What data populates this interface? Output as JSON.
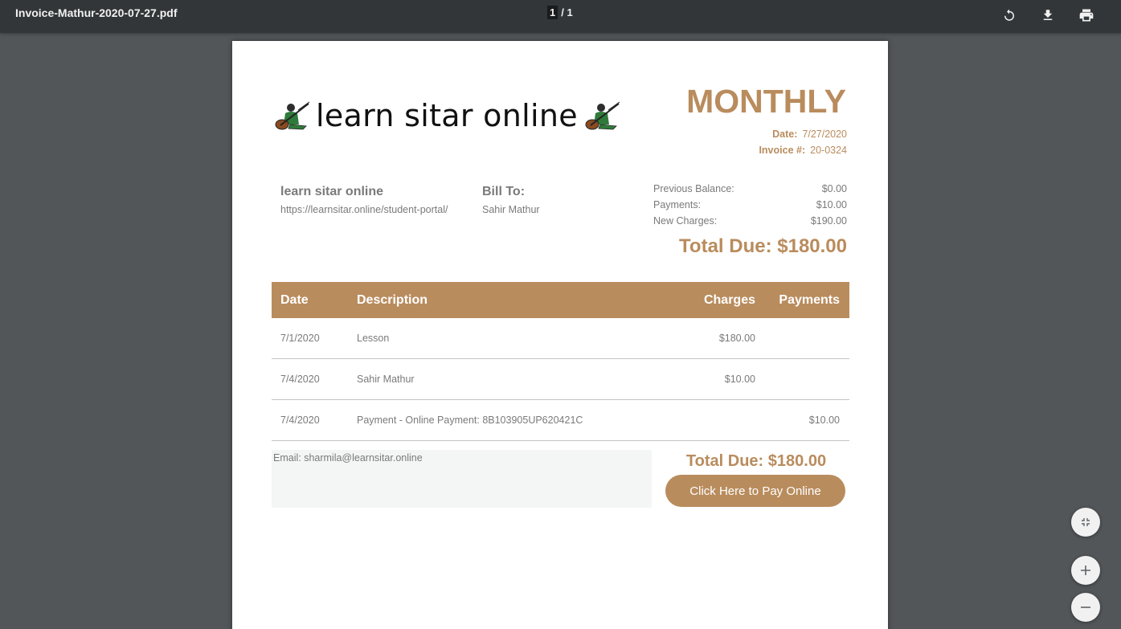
{
  "viewer": {
    "file_name": "Invoice-Mathur-2020-07-27.pdf",
    "page_current": "1",
    "page_total": "/ 1",
    "icons": [
      "rotate-icon",
      "download-icon",
      "print-icon",
      "fit-page-icon",
      "zoom-in-icon",
      "zoom-out-icon"
    ]
  },
  "invoice": {
    "logo_text": "learn sitar online",
    "type": "MONTHLY",
    "date_label": "Date:",
    "date_value": "7/27/2020",
    "number_label": "Invoice #:",
    "number_value": "20-0324",
    "from_name": "learn sitar online",
    "from_url": "https://learnsitar.online/student-portal/",
    "bill_to_label": "Bill To:",
    "bill_to_name": "Sahir Mathur",
    "summary": [
      {
        "label": "Previous Balance:",
        "value": "$0.00"
      },
      {
        "label": "Payments:",
        "value": "$10.00"
      },
      {
        "label": "New Charges:",
        "value": "$190.00"
      }
    ],
    "total_due": "Total Due: $180.00",
    "table": {
      "headers": {
        "date": "Date",
        "description": "Description",
        "charges": "Charges",
        "payments": "Payments"
      },
      "rows": [
        {
          "date": "7/1/2020",
          "description": "Lesson",
          "charges": "$180.00",
          "payments": ""
        },
        {
          "date": "7/4/2020",
          "description": "Sahir Mathur",
          "charges": "$10.00",
          "payments": ""
        },
        {
          "date": "7/4/2020",
          "description": "Payment - Online Payment: 8B103905UP620421C",
          "charges": "",
          "payments": "$10.00"
        }
      ]
    },
    "email_note": "Email: sharmila@learnsitar.online",
    "total_due_bottom": "Total Due: $180.00",
    "pay_button": "Click Here to Pay Online"
  },
  "colors": {
    "accent": "#b98c5d",
    "toolbar": "#323639",
    "viewer_bg": "#525659",
    "text_gray": "#7a7a7a"
  }
}
